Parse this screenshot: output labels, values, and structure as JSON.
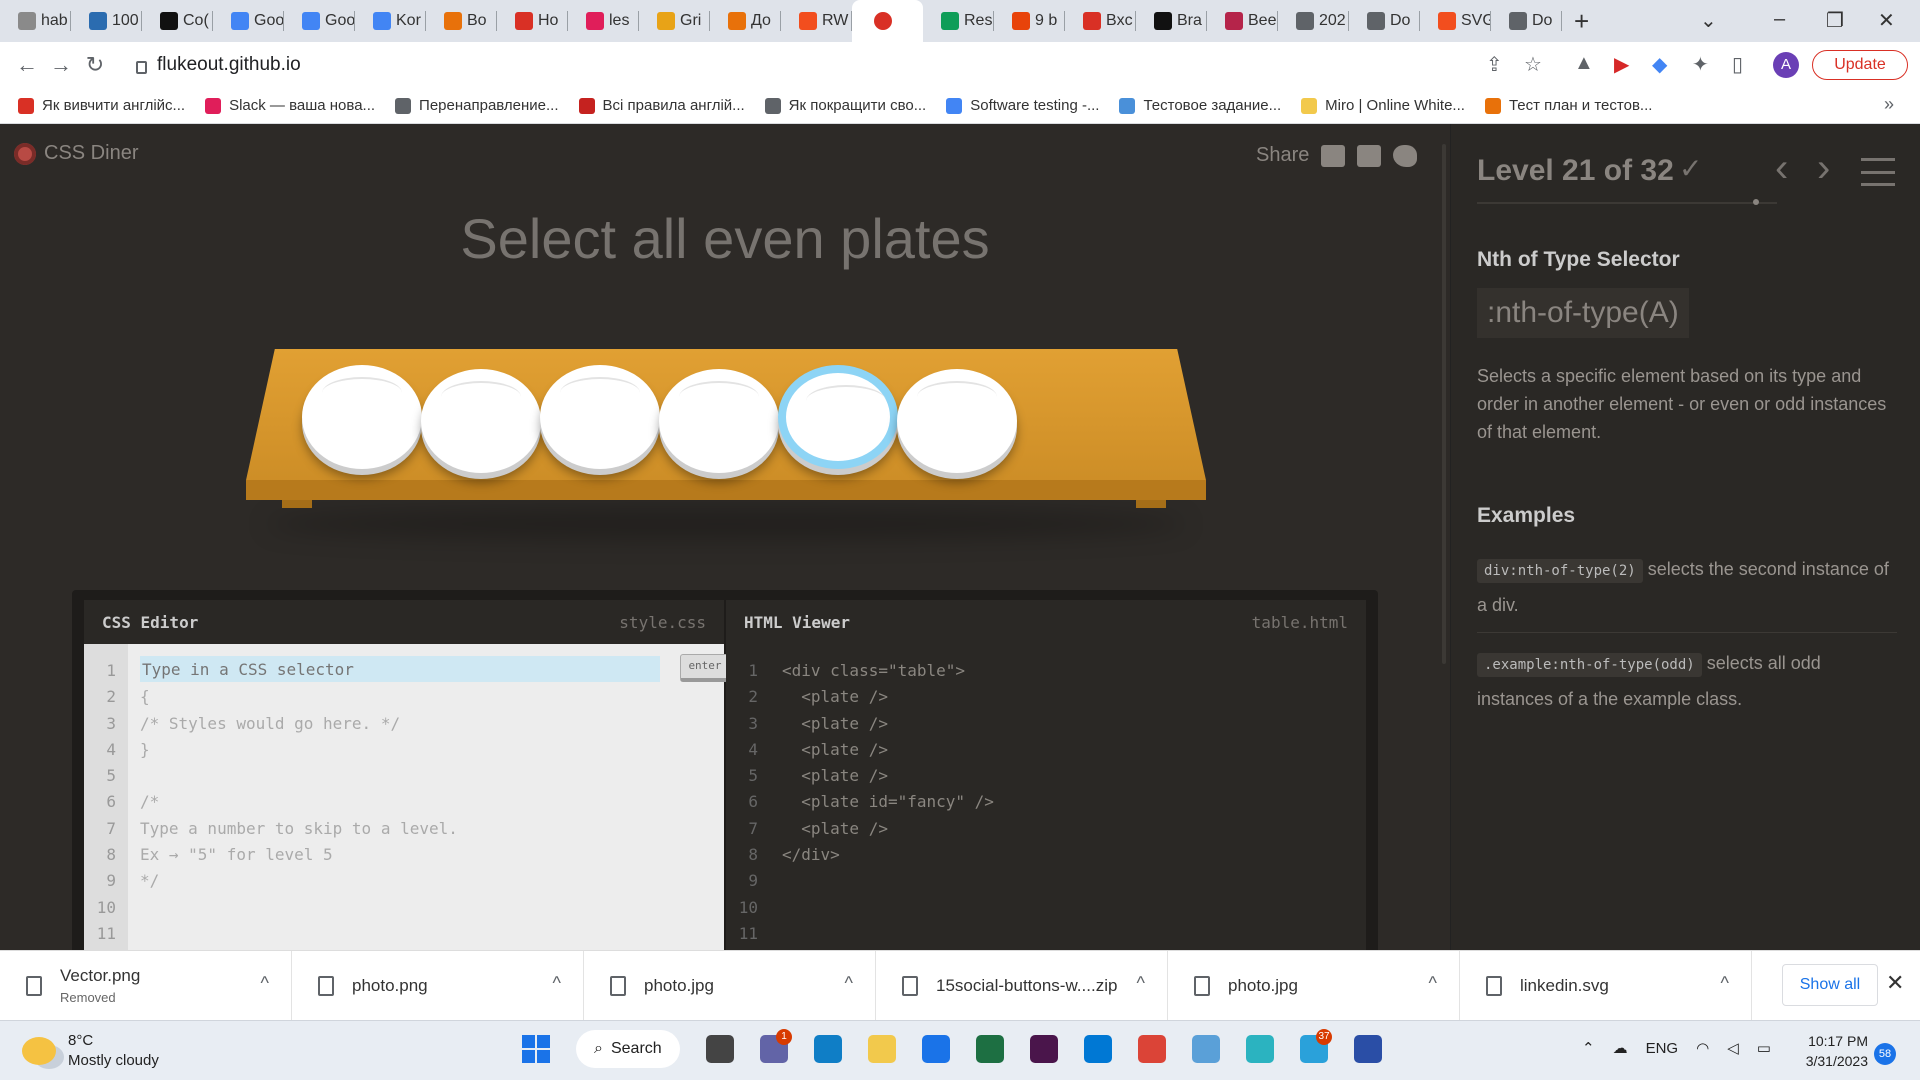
{
  "browser": {
    "tabs": [
      {
        "label": "hab",
        "color": "#8a8a8a"
      },
      {
        "label": "100",
        "color": "#2b6cb0"
      },
      {
        "label": "Co(",
        "color": "#111111"
      },
      {
        "label": "Goo",
        "color": "#4285f4"
      },
      {
        "label": "Goo",
        "color": "#4285f4"
      },
      {
        "label": "Kor",
        "color": "#4285f4"
      },
      {
        "label": "Bo",
        "color": "#e8710a"
      },
      {
        "label": "Ho",
        "color": "#d93025"
      },
      {
        "label": "les",
        "color": "#e01e5a"
      },
      {
        "label": "Gri",
        "color": "#e8a317"
      },
      {
        "label": "До",
        "color": "#e8710a"
      },
      {
        "label": "RW",
        "color": "#f24e1e"
      },
      {
        "label": "",
        "color": "#d93025",
        "active": true
      },
      {
        "label": "Res",
        "color": "#0f9d58"
      },
      {
        "label": "9 b",
        "color": "#e8430a"
      },
      {
        "label": "Bxc",
        "color": "#d93025"
      },
      {
        "label": "Bra",
        "color": "#111111"
      },
      {
        "label": "Bee",
        "color": "#b5244a"
      },
      {
        "label": "202",
        "color": "#5f6368"
      },
      {
        "label": "Do",
        "color": "#5f6368"
      },
      {
        "label": "SVG",
        "color": "#f24e1e"
      },
      {
        "label": "Do",
        "color": "#5f6368"
      }
    ],
    "close_glyph": "✕",
    "newtab_glyph": "+",
    "url": "flukeout.github.io",
    "profile_initial": "A",
    "update_label": "Update",
    "bookmarks": [
      {
        "label": "Як вивчити англійс...",
        "color": "#d93025"
      },
      {
        "label": "Slack — ваша нова...",
        "color": "#e01e5a"
      },
      {
        "label": "Перенаправление...",
        "color": "#5f6368"
      },
      {
        "label": "Всі правила англій...",
        "color": "#c5221f"
      },
      {
        "label": "Як покращити сво...",
        "color": "#5f6368"
      },
      {
        "label": "Software testing -...",
        "color": "#4285f4"
      },
      {
        "label": "Тестовое задание...",
        "color": "#4a90d9"
      },
      {
        "label": "Miro | Online White...",
        "color": "#f2c94c"
      },
      {
        "label": "Тест план и тестов...",
        "color": "#e8710a"
      }
    ],
    "more_glyph": "»"
  },
  "app": {
    "logo_text": "CSS Diner",
    "share_label": "Share",
    "instruction": "Select all even plates",
    "plates": [
      {
        "fancy": false
      },
      {
        "fancy": false
      },
      {
        "fancy": false
      },
      {
        "fancy": false
      },
      {
        "fancy": true
      },
      {
        "fancy": false
      }
    ],
    "css_editor": {
      "title": "CSS Editor",
      "filename": "style.css",
      "placeholder": "Type in a CSS selector",
      "enter_label": "enter",
      "line_numbers": "1\n2\n3\n4\n5\n6\n7\n8\n9\n10\n11",
      "code": "\n{\n/* Styles would go here. */\n}\n\n/*\nType a number to skip to a level.\nEx → \"5\" for level 5\n*/"
    },
    "html_viewer": {
      "title": "HTML Viewer",
      "filename": "table.html",
      "line_numbers": "1\n2\n3\n4\n5\n6\n7\n8\n9\n10\n11",
      "code": "<div class=\"table\">\n  <plate />\n  <plate />\n  <plate />\n  <plate />\n  <plate id=\"fancy\" />\n  <plate />\n</div>"
    },
    "sidebar": {
      "level": "Level 21 of 32",
      "check_glyph": "✓",
      "prev_glyph": "‹",
      "next_glyph": "›",
      "heading": "Nth of Type Selector",
      "syntax": ":nth-of-type(A)",
      "description": "Selects a specific element based on its type and order in another element - or even or odd instances of that element.",
      "examples_heading": "Examples",
      "examples": [
        {
          "code": "div:nth-of-type(2)",
          "text": " selects the second instance of a div."
        },
        {
          "code": ".example:nth-of-type(odd)",
          "text": " selects all odd instances of a the example class."
        }
      ]
    }
  },
  "downloads": {
    "items": [
      {
        "name": "Vector.png",
        "status": "Removed"
      },
      {
        "name": "photo.png",
        "status": ""
      },
      {
        "name": "photo.jpg",
        "status": ""
      },
      {
        "name": "15social-buttons-w....zip",
        "status": ""
      },
      {
        "name": "photo.jpg",
        "status": ""
      },
      {
        "name": "linkedin.svg",
        "status": ""
      }
    ],
    "chevron_glyph": "^",
    "show_all_label": "Show all",
    "close_glyph": "✕"
  },
  "taskbar": {
    "temperature": "8°C",
    "weather": "Mostly cloudy",
    "search_label": "Search",
    "apps": [
      {
        "name": "file-explorer",
        "color": "#444444"
      },
      {
        "name": "teams",
        "color": "#6264a7",
        "badge": "1"
      },
      {
        "name": "edge",
        "color": "#0f7ec6"
      },
      {
        "name": "folder",
        "color": "#f2c94c"
      },
      {
        "name": "store",
        "color": "#1a73e8"
      },
      {
        "name": "excel",
        "color": "#1d6f42"
      },
      {
        "name": "slack",
        "color": "#4a154b"
      },
      {
        "name": "vscode",
        "color": "#0078d4"
      },
      {
        "name": "chrome",
        "color": "#db4437"
      },
      {
        "name": "paint",
        "color": "#5aa0d8"
      },
      {
        "name": "app-cyan",
        "color": "#2bb3c0"
      },
      {
        "name": "telegram",
        "color": "#2aa1da",
        "badge": "37"
      },
      {
        "name": "save-app",
        "color": "#2a4ea6"
      }
    ],
    "lang": "ENG",
    "time": "10:17 PM",
    "date": "3/31/2023",
    "notifications": "58"
  }
}
